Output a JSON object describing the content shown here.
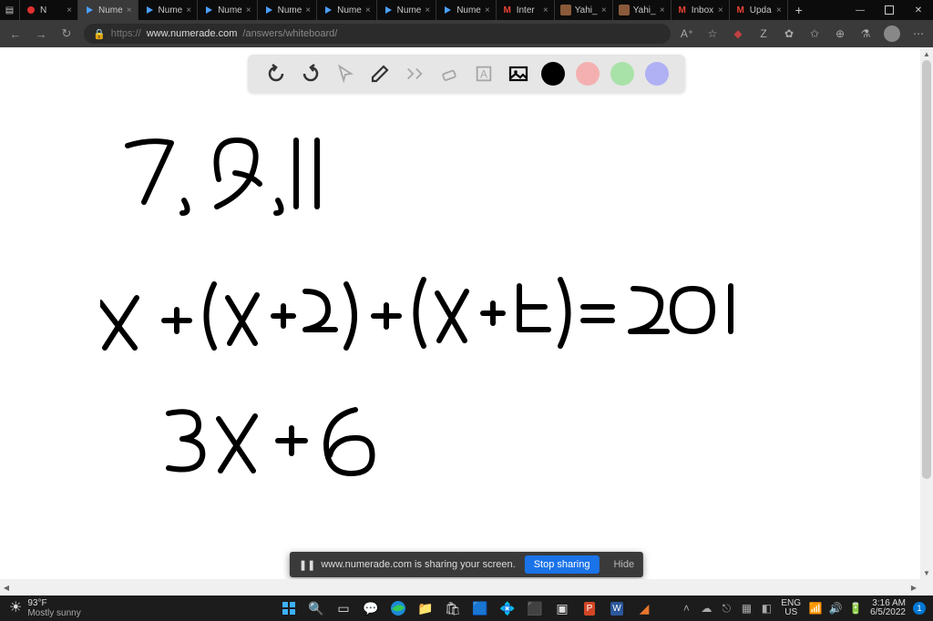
{
  "browser": {
    "tabs": [
      {
        "title": "N",
        "kind": "rec"
      },
      {
        "title": "Nume",
        "kind": "numerade",
        "active": true
      },
      {
        "title": "Nume",
        "kind": "numerade"
      },
      {
        "title": "Nume",
        "kind": "numerade"
      },
      {
        "title": "Nume",
        "kind": "numerade"
      },
      {
        "title": "Nume",
        "kind": "numerade"
      },
      {
        "title": "Nume",
        "kind": "numerade"
      },
      {
        "title": "Nume",
        "kind": "numerade"
      },
      {
        "title": "Inter",
        "kind": "gmail"
      },
      {
        "title": "Yahi_",
        "kind": "yahi"
      },
      {
        "title": "Yahi_",
        "kind": "yahi"
      },
      {
        "title": "Inbox",
        "kind": "gmail"
      },
      {
        "title": "Upda",
        "kind": "gmail"
      }
    ],
    "url_proto": "https://",
    "url_domain": "www.numerade.com",
    "url_path": "/answers/whiteboard/"
  },
  "whiteboard": {
    "tools": {
      "undo": "undo",
      "redo": "redo",
      "select": "select",
      "pen": "pen",
      "math": "math",
      "eraser": "eraser",
      "text": "text",
      "image": "image"
    },
    "colors": [
      "black",
      "pink",
      "green",
      "purple"
    ],
    "handwriting": {
      "line1": "7, 9, 11",
      "line2": "x + (x+2) + (x+4) = 201",
      "line3": "3x + 6"
    }
  },
  "sharebar": {
    "message": "www.numerade.com is sharing your screen.",
    "stop": "Stop sharing",
    "hide": "Hide"
  },
  "taskbar": {
    "weather_temp": "93°F",
    "weather_desc": "Mostly sunny",
    "lang_code": "ENG",
    "lang_region": "US",
    "time": "3:16 AM",
    "date": "6/5/2022",
    "notif_count": "1"
  }
}
